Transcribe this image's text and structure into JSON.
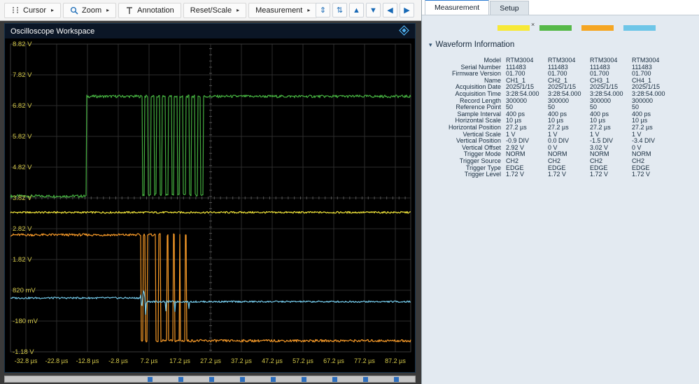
{
  "workspace": {
    "title": "Oscilloscope Workspace"
  },
  "toolbar": {
    "accent_color": "#1668b5",
    "menus": [
      {
        "label": "Cursor",
        "icon": "cursor-icon",
        "has_dropdown": true
      },
      {
        "label": "Zoom",
        "icon": "zoom-icon",
        "has_dropdown": true
      },
      {
        "label": "Annotation",
        "icon": "annotation-icon",
        "has_dropdown": false
      },
      {
        "label": "Reset/Scale",
        "icon": null,
        "has_dropdown": true
      },
      {
        "label": "Measurement",
        "icon": null,
        "has_dropdown": true
      }
    ],
    "arrow_buttons": [
      {
        "name": "expand-vertical-button",
        "glyph": "⇕"
      },
      {
        "name": "compress-vertical-button",
        "glyph": "⇅"
      },
      {
        "name": "move-up-button",
        "glyph": "▲"
      },
      {
        "name": "move-down-button",
        "glyph": "▼"
      },
      {
        "name": "move-left-button",
        "glyph": "◀"
      },
      {
        "name": "move-right-button",
        "glyph": "▶"
      }
    ]
  },
  "scrollbar": {
    "square_count": 9
  },
  "chart_data": {
    "type": "line",
    "title": "Oscilloscope Workspace",
    "x_unit": "µs",
    "y_unit": "V",
    "x_range": [
      -37.8,
      92.2
    ],
    "y_range": [
      -1.18,
      8.82
    ],
    "x_tick_values": [
      -32.8,
      -22.8,
      -12.8,
      -2.8,
      7.2,
      17.2,
      27.2,
      37.2,
      47.2,
      57.2,
      67.2,
      77.2,
      87.2
    ],
    "x_tick_labels": [
      "-32.8 µs",
      "-22.8 µs",
      "-12.8 µs",
      "-2.8 µs",
      "7.2 µs",
      "17.2 µs",
      "27.2 µs",
      "37.2 µs",
      "47.2 µs",
      "57.2 µs",
      "67.2 µs",
      "77.2 µs",
      "87.2 µs"
    ],
    "y_tick_values": [
      8.82,
      7.82,
      6.82,
      5.82,
      4.82,
      3.82,
      2.82,
      1.82,
      0.82,
      -0.18,
      -1.18
    ],
    "y_tick_labels": [
      "8.82 V",
      "7.82 V",
      "6.82 V",
      "5.82 V",
      "4.82 V",
      "3.82 V",
      "2.82 V",
      "1.82 V",
      "820 mV",
      "-180 mV",
      "-1.18 V"
    ],
    "grid": true,
    "grid_color": "#2c2c2c",
    "axis_label_color": "#d6ca4a",
    "background": "#000000",
    "center_axis": {
      "horizontal_v": 3.82,
      "vertical_t": 27.2
    },
    "series": [
      {
        "name": "CH2_1",
        "color": "#44ad3f",
        "noise": 0.045,
        "steps": [
          [
            -37.8,
            3.88
          ],
          [
            -13.2,
            7.12
          ],
          [
            5.0,
            3.92
          ],
          [
            5.8,
            7.12
          ],
          [
            6.9,
            3.92
          ],
          [
            7.7,
            7.12
          ],
          [
            8.8,
            3.92
          ],
          [
            9.6,
            7.12
          ],
          [
            10.7,
            3.92
          ],
          [
            11.5,
            7.12
          ],
          [
            12.6,
            3.92
          ],
          [
            13.4,
            7.12
          ],
          [
            14.5,
            3.92
          ],
          [
            15.3,
            7.12
          ],
          [
            16.4,
            3.92
          ],
          [
            17.2,
            7.12
          ],
          [
            18.3,
            3.92
          ],
          [
            19.1,
            7.12
          ],
          [
            20.2,
            3.92
          ],
          [
            21.0,
            7.12
          ],
          [
            22.1,
            3.92
          ],
          [
            22.9,
            7.12
          ],
          [
            24.0,
            3.92
          ],
          [
            24.8,
            7.12
          ]
        ]
      },
      {
        "name": "CH1_1",
        "color": "#f0e43a",
        "noise": 0.03,
        "steps": [
          [
            -37.8,
            3.35
          ]
        ]
      },
      {
        "name": "CH3_1",
        "color": "#f79a28",
        "noise": 0.04,
        "steps": [
          [
            -37.8,
            2.62
          ],
          [
            4.6,
            -0.82
          ],
          [
            5.3,
            2.62
          ],
          [
            5.9,
            -0.82
          ],
          [
            6.6,
            2.62
          ],
          [
            9.4,
            -0.82
          ],
          [
            10.2,
            2.62
          ],
          [
            10.9,
            -0.82
          ],
          [
            13.0,
            2.62
          ],
          [
            13.5,
            -0.82
          ],
          [
            15.0,
            2.62
          ],
          [
            15.5,
            -0.82
          ],
          [
            17.0,
            2.62
          ],
          [
            17.4,
            -0.82
          ],
          [
            19.0,
            2.62
          ],
          [
            19.4,
            -0.82
          ]
        ]
      },
      {
        "name": "CH4_1",
        "color": "#72c7e7",
        "noise": 0.028,
        "burst": {
          "range": [
            4.3,
            6.5
          ],
          "amp": 0.45
        },
        "steps": [
          [
            -37.8,
            0.57
          ],
          [
            4.3,
            0.45
          ],
          [
            9.5,
            0.14
          ],
          [
            9.7,
            0.45
          ],
          [
            12.5,
            0.14
          ],
          [
            12.7,
            0.45
          ],
          [
            15.5,
            0.14
          ],
          [
            15.7,
            0.45
          ],
          [
            20.0,
            0.2
          ],
          [
            20.2,
            0.45
          ]
        ]
      }
    ]
  },
  "right_panel": {
    "tabs": [
      {
        "label": "Measurement",
        "active": true
      },
      {
        "label": "Setup",
        "active": false
      }
    ],
    "swatches": [
      {
        "color": "#f7e938",
        "close": true
      },
      {
        "color": "#56b949",
        "close": false
      },
      {
        "color": "#f5a623",
        "close": false
      },
      {
        "color": "#6ec6e8",
        "close": false
      }
    ],
    "section_title": "Waveform Information",
    "table": {
      "rows": [
        {
          "label": "Model",
          "values": [
            "RTM3004",
            "RTM3004",
            "RTM3004",
            "RTM3004"
          ]
        },
        {
          "label": "Serial Number",
          "values": [
            "111483",
            "111483",
            "111483",
            "111483"
          ]
        },
        {
          "label": "Firmware Version",
          "values": [
            "01.700",
            "01.700",
            "01.700",
            "01.700"
          ]
        },
        {
          "label": "Name",
          "values": [
            "CH1_1",
            "CH2_1",
            "CH3_1",
            "CH4_1"
          ]
        },
        {
          "label": "Acquisition Date",
          "values": [
            "2025/1/15",
            "2025/1/15",
            "2025/1/15",
            "2025/1/15"
          ]
        },
        {
          "label": "Acquisition Time",
          "values": [
            "3:28:54.000",
            "3:28:54.000",
            "3:28:54.000",
            "3:28:54.000"
          ]
        },
        {
          "label": "Record Length",
          "values": [
            "300000",
            "300000",
            "300000",
            "300000"
          ]
        },
        {
          "label": "Reference Point",
          "values": [
            "50",
            "50",
            "50",
            "50"
          ]
        },
        {
          "label": "Sample Interval",
          "values": [
            "400 ps",
            "400 ps",
            "400 ps",
            "400 ps"
          ]
        },
        {
          "label": "Horizontal Scale",
          "values": [
            "10 µs",
            "10 µs",
            "10 µs",
            "10 µs"
          ]
        },
        {
          "label": "Horizontal Position",
          "values": [
            "27.2 µs",
            "27.2 µs",
            "27.2 µs",
            "27.2 µs"
          ]
        },
        {
          "label": "Vertical Scale",
          "values": [
            "1 V",
            "1 V",
            "1 V",
            "1 V"
          ]
        },
        {
          "label": "Vertical Position",
          "values": [
            "-0.9 DIV",
            "0.0 DIV",
            "-1.5 DIV",
            "-3.4 DIV"
          ]
        },
        {
          "label": "Vertical Offset",
          "values": [
            "2.92 V",
            "0 V",
            "3.02 V",
            "0 V"
          ]
        },
        {
          "label": "Trigger Mode",
          "values": [
            "NORM",
            "NORM",
            "NORM",
            "NORM"
          ]
        },
        {
          "label": "Trigger Source",
          "values": [
            "CH2",
            "CH2",
            "CH2",
            "CH2"
          ]
        },
        {
          "label": "Trigger Type",
          "values": [
            "EDGE",
            "EDGE",
            "EDGE",
            "EDGE"
          ]
        },
        {
          "label": "Trigger Level",
          "values": [
            "1.72 V",
            "1.72 V",
            "1.72 V",
            "1.72 V"
          ]
        }
      ]
    }
  }
}
